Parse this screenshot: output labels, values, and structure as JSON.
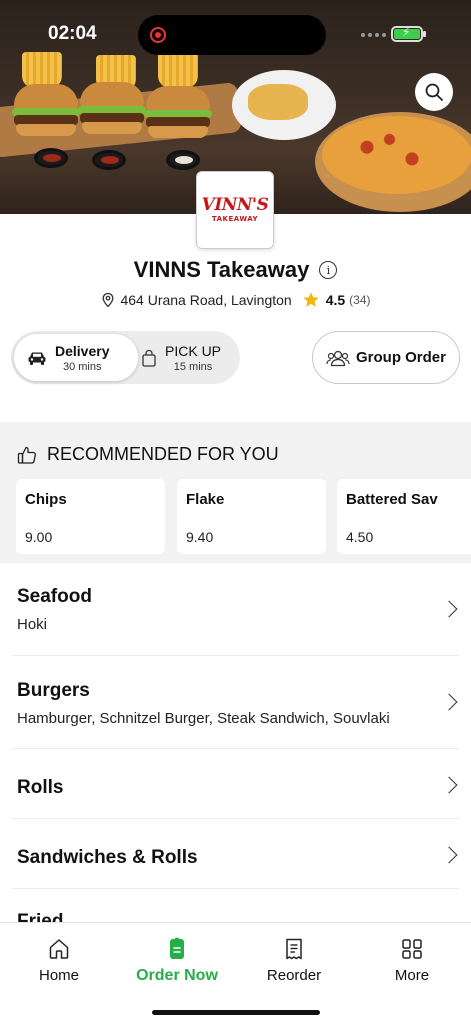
{
  "status_bar": {
    "time": "02:04"
  },
  "restaurant": {
    "logo_main": "VINN'S",
    "logo_sub": "TAKEAWAY",
    "name": "VINNS Takeaway",
    "address": "464 Urana Road, Lavington",
    "rating": "4.5",
    "rating_count": "(34)"
  },
  "order_modes": {
    "delivery": {
      "label": "Delivery",
      "time": "30 mins"
    },
    "pickup": {
      "label": "PICK UP",
      "time": "15 mins"
    },
    "group_order": "Group Order"
  },
  "recommended": {
    "title": "RECOMMENDED FOR YOU",
    "items": [
      {
        "name": "Chips",
        "price": "9.00"
      },
      {
        "name": "Flake",
        "price": "9.40"
      },
      {
        "name": "Battered Sav",
        "price": "4.50"
      }
    ]
  },
  "categories": [
    {
      "name": "Seafood",
      "items": "Hoki"
    },
    {
      "name": "Burgers",
      "items": "Hamburger, Schnitzel Burger, Steak Sandwich, Souvlaki"
    },
    {
      "name": "Rolls",
      "items": ""
    },
    {
      "name": "Sandwiches & Rolls",
      "items": ""
    },
    {
      "name": "Fried",
      "items": ""
    }
  ],
  "nav": {
    "home": "Home",
    "order_now": "Order Now",
    "reorder": "Reorder",
    "more": "More"
  },
  "colors": {
    "accent_green": "#27ae48",
    "logo_red": "#c8151b",
    "star": "#f2b60f",
    "battery": "#3ccf4e"
  }
}
